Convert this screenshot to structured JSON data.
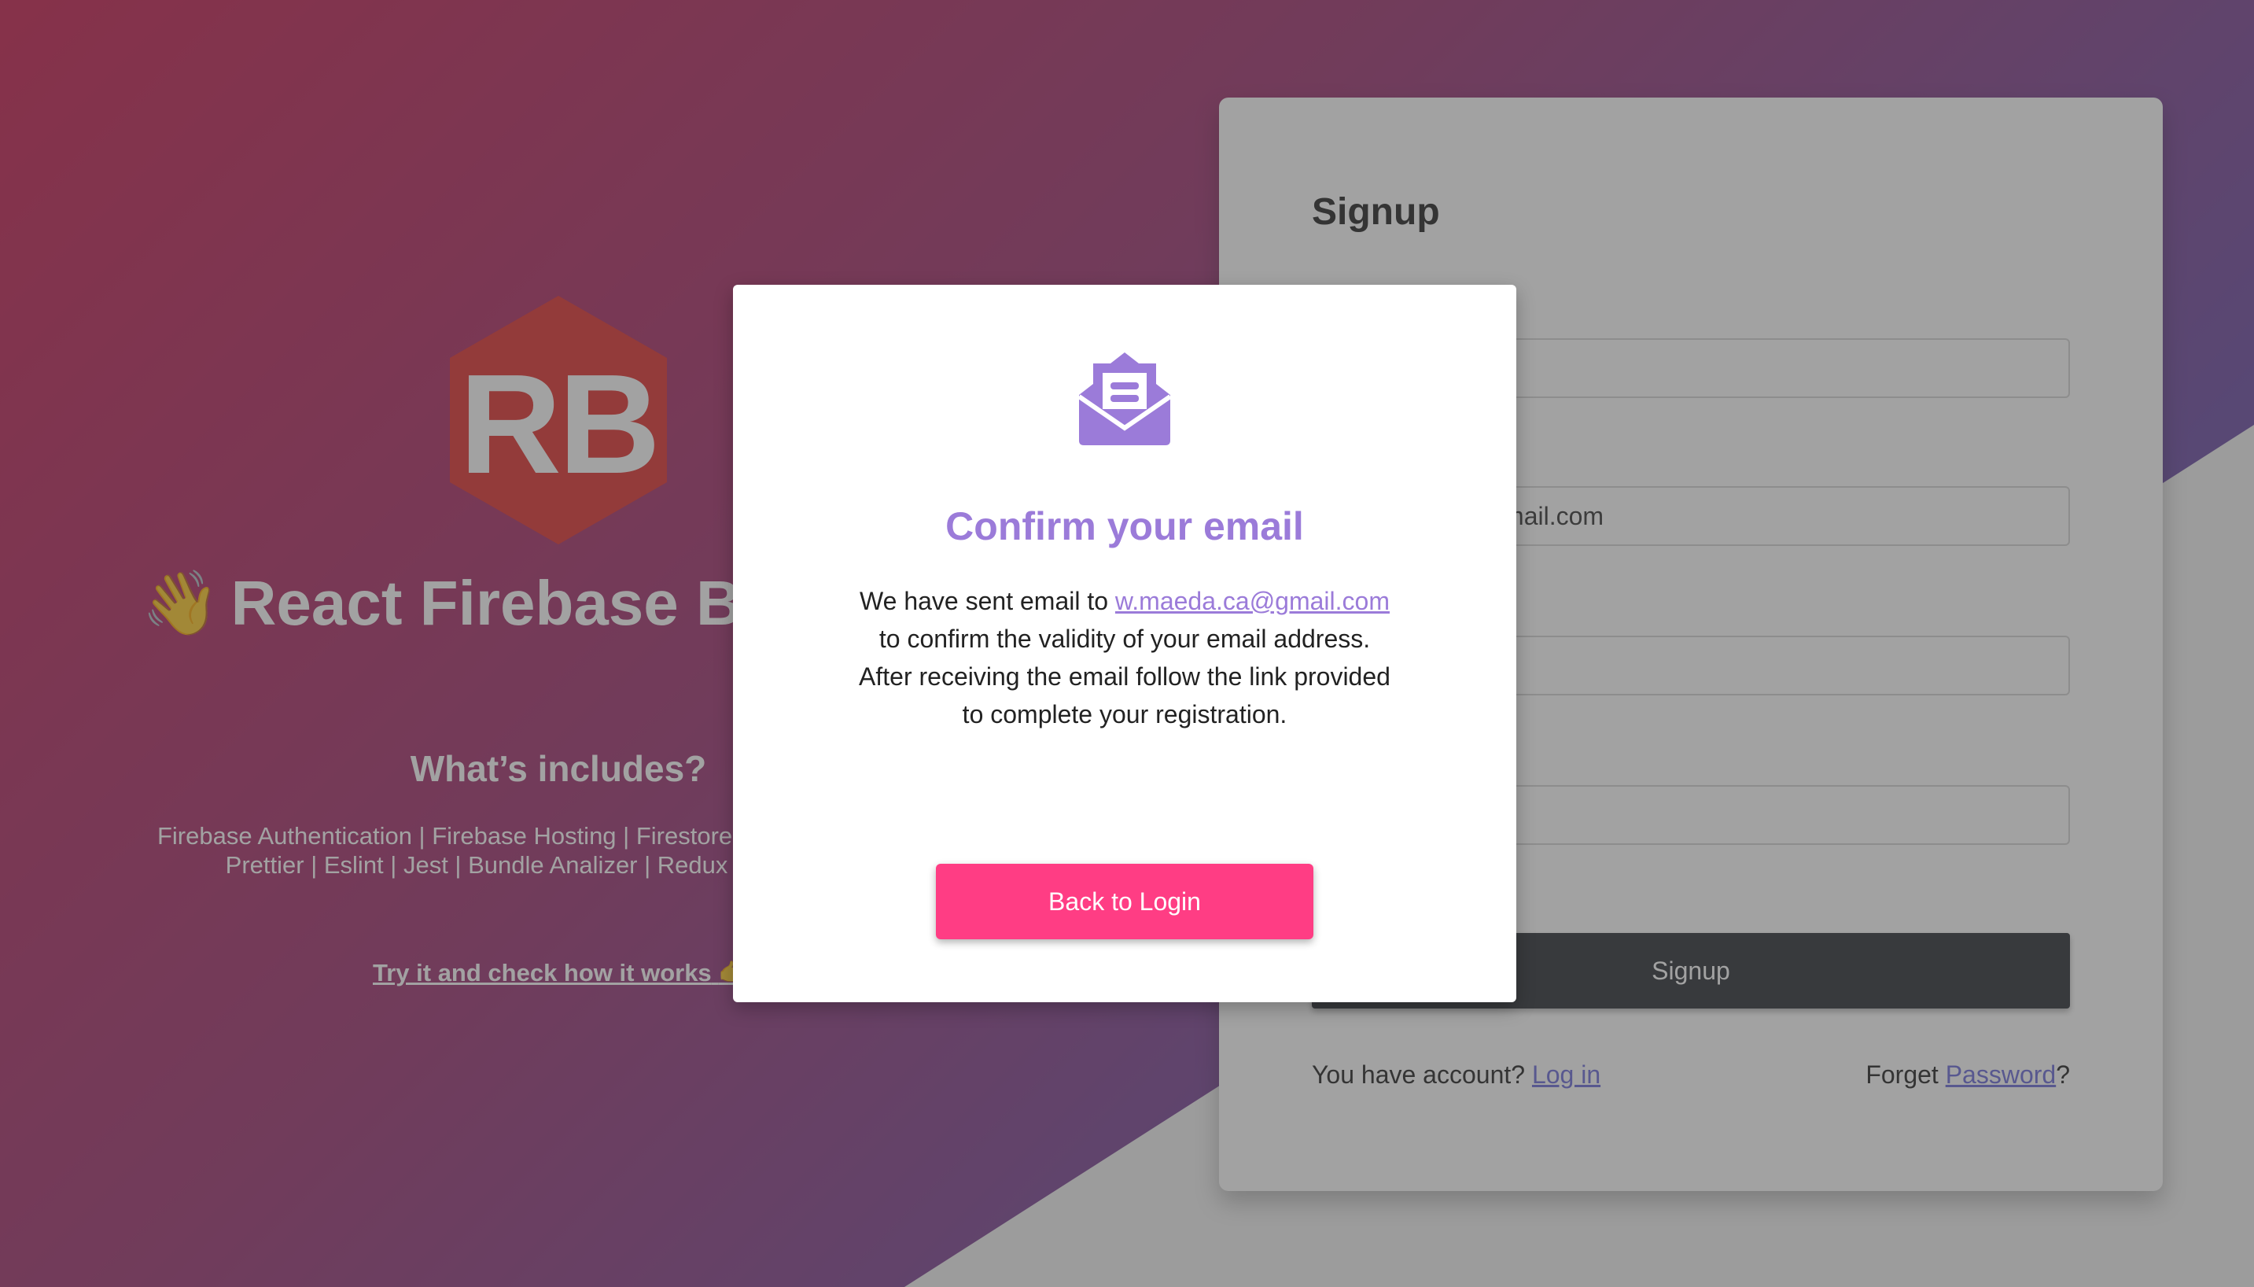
{
  "hero": {
    "logo_text": "RB",
    "wave_emoji": "👋",
    "title": "React Firebase Boilerplate",
    "subtitle": "What’s includes?",
    "features_line1": "Firebase Authentication | Firebase Hosting | Firestore | Firebase Functions",
    "features_line2": "Prettier | Eslint | Jest | Bundle Analizer | Redux | React Router",
    "try_link": "Try it and check how it works",
    "hand_emoji": "👉"
  },
  "signup": {
    "title": "Signup",
    "fields": [
      {
        "value": ""
      },
      {
        "value": "w.maeda.ca@gmail.com"
      },
      {
        "value": ""
      },
      {
        "value": ""
      }
    ],
    "submit_label": "Signup",
    "have_account_text": "You have account?",
    "login_link": "Log in",
    "forget_text": "Forget",
    "password_link": "Password",
    "question_mark": "?"
  },
  "modal": {
    "icon": "envelope-open-text-icon",
    "title": "Confirm your email",
    "body_prefix": "We have sent email to",
    "email": "w.maeda.ca@gmail.com",
    "body_suffix": "to confirm the validity of your email address. After receiving the email follow the link provided to complete your registration.",
    "button_label": "Back to Login"
  },
  "colors": {
    "accent_purple": "#9b7bd9",
    "button_pink": "#ff3d84",
    "signup_dark": "#2b2f35",
    "logo_red": "#e0302e"
  }
}
